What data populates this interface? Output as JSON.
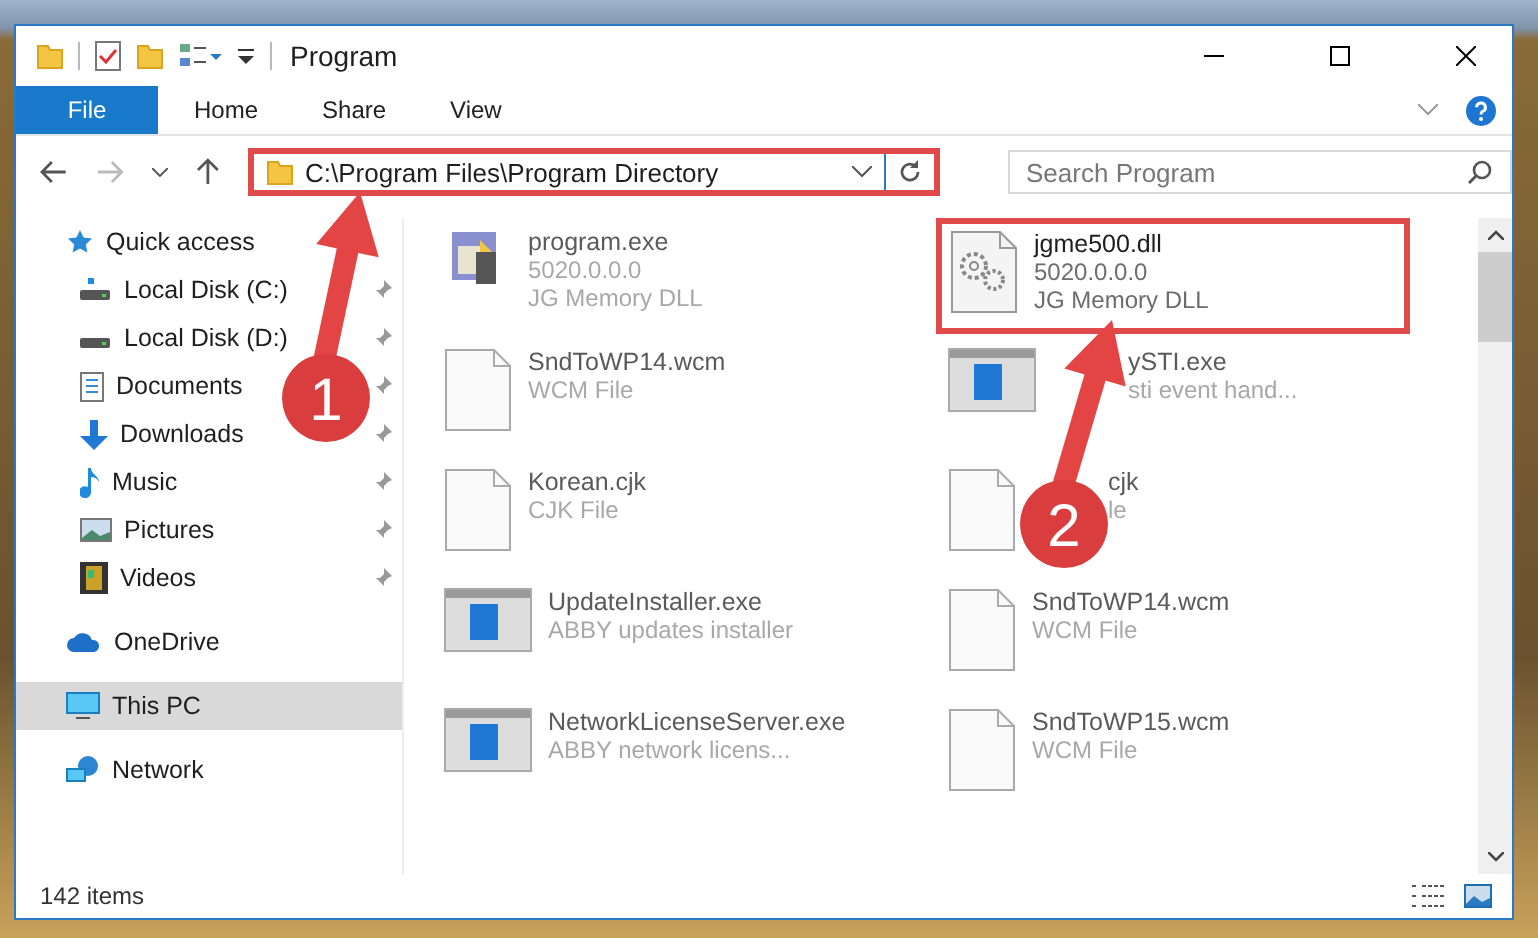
{
  "window": {
    "title": "Program"
  },
  "ribbon": {
    "tabs": [
      {
        "label": "File",
        "kind": "file"
      },
      {
        "label": "Home",
        "kind": "tab"
      },
      {
        "label": "Share",
        "kind": "tab"
      },
      {
        "label": "View",
        "kind": "tab"
      }
    ]
  },
  "address": {
    "path": "C:\\Program Files\\Program Directory",
    "highlighted": true
  },
  "search": {
    "placeholder": "Search Program"
  },
  "sidebar": {
    "items": [
      {
        "label": "Quick access",
        "selected": false,
        "children": [
          {
            "label": "Local Disk (C:)",
            "pinned": true,
            "selected": false
          },
          {
            "label": "Local Disk (D:)",
            "pinned": true,
            "selected": false
          },
          {
            "label": "Documents",
            "pinned": true,
            "selected": false
          },
          {
            "label": "Downloads",
            "pinned": true,
            "selected": false
          },
          {
            "label": "Music",
            "pinned": true,
            "selected": false
          },
          {
            "label": "Pictures",
            "pinned": true,
            "selected": false
          },
          {
            "label": "Videos",
            "pinned": true,
            "selected": false
          }
        ]
      },
      {
        "label": "OneDrive",
        "selected": false
      },
      {
        "label": "This PC",
        "selected": true
      },
      {
        "label": "Network",
        "selected": false
      }
    ]
  },
  "files": [
    {
      "kind": "app",
      "name": "program.exe",
      "details": [
        "5020.0.0.0",
        "JG Memory DLL"
      ],
      "blurred": true,
      "highlighted": false
    },
    {
      "kind": "dll",
      "name": "jgme500.dll",
      "details": [
        "5020.0.0.0",
        "JG Memory DLL"
      ],
      "blurred": false,
      "highlighted": true
    },
    {
      "kind": "doc",
      "name": "SndToWP14.wcm",
      "details": [
        "WCM File"
      ],
      "blurred": true,
      "highlighted": false
    },
    {
      "kind": "window",
      "name": "ySTI.exe",
      "details": [
        "sti event hand..."
      ],
      "blurred": true,
      "highlighted": false
    },
    {
      "kind": "doc",
      "name": "Korean.cjk",
      "details": [
        "CJK File"
      ],
      "blurred": true,
      "highlighted": false
    },
    {
      "kind": "doc",
      "name": "cjk",
      "details": [
        "le"
      ],
      "blurred": true,
      "highlighted": false
    },
    {
      "kind": "window",
      "name": "UpdateInstaller.exe",
      "details": [
        "ABBY updates installer"
      ],
      "blurred": true,
      "highlighted": false
    },
    {
      "kind": "doc",
      "name": "SndToWP14.wcm",
      "details": [
        "WCM File"
      ],
      "blurred": true,
      "highlighted": false
    },
    {
      "kind": "window",
      "name": "NetworkLicenseServer.exe",
      "details": [
        "ABBY network licens..."
      ],
      "blurred": true,
      "highlighted": false
    },
    {
      "kind": "doc",
      "name": "SndToWP15.wcm",
      "details": [
        "WCM File"
      ],
      "blurred": true,
      "highlighted": false
    }
  ],
  "status_bar": {
    "count": "142 items"
  },
  "annotations": [
    {
      "number": "1"
    },
    {
      "number": "2"
    }
  ]
}
